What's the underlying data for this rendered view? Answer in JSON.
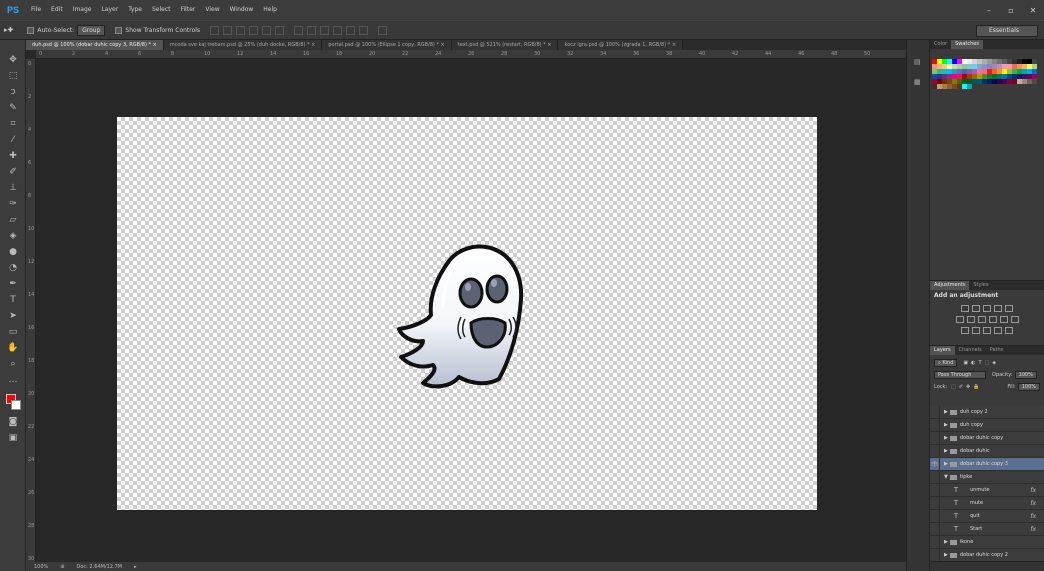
{
  "app": {
    "logo": "PS"
  },
  "menu": [
    "File",
    "Edit",
    "Image",
    "Layer",
    "Type",
    "Select",
    "Filter",
    "View",
    "Window",
    "Help"
  ],
  "window_controls": [
    "–",
    "▫",
    "✕"
  ],
  "options_bar": {
    "move_tool_glyph": "▸✚",
    "auto_select_label": "Auto-Select:",
    "auto_select_value": "Group",
    "show_transform_label": "Show Transform Controls",
    "workspace": "Essentials"
  },
  "doc_tabs": [
    "duh.psd @ 100% (dobar duhic copy 3, RGB/8) * ×",
    "mcoda sve kaj trebam.psd @ 25% (duh docke, RGB/8) * ×",
    "portal.psd @ 100% (Ellipse 1 copy, RGB/8) * ×",
    "text.psd @ 521% (restart, RGB/8) * ×",
    "kocz igra.psd @ 100% (zgrada 1, RGB/8) * ×"
  ],
  "ruler_h": [
    "0",
    "2",
    "4",
    "6",
    "8",
    "10",
    "12",
    "14",
    "16",
    "18",
    "20",
    "22",
    "24",
    "26",
    "28",
    "30",
    "32",
    "34",
    "36",
    "38",
    "40",
    "42",
    "44",
    "46",
    "48",
    "50"
  ],
  "ruler_v": [
    "0",
    "2",
    "4",
    "6",
    "8",
    "10",
    "12",
    "14",
    "16",
    "18",
    "20",
    "22",
    "24",
    "26",
    "28",
    "30"
  ],
  "status": {
    "zoom": "100%",
    "doc_info": "Doc: 2.64M/12.7M"
  },
  "swatches_panel": {
    "tabs": [
      "Color",
      "Swatches"
    ],
    "active": "Swatches"
  },
  "swatch_colors": [
    "#ff0000",
    "#ffff00",
    "#00ff00",
    "#00ffff",
    "#0000ff",
    "#ff00ff",
    "#ffffff",
    "#ebebeb",
    "#d6d6d6",
    "#c2c2c2",
    "#adadad",
    "#999999",
    "#858585",
    "#707070",
    "#5c5c5c",
    "#474747",
    "#333333",
    "#1f1f1f",
    "#0a0a0a",
    "#000000",
    "#444444",
    "#f7977a",
    "#f9ad81",
    "#fdc68a",
    "#fff79a",
    "#c4df9b",
    "#a2d39c",
    "#82ca9d",
    "#7bcdc8",
    "#6ecff6",
    "#7ea7d8",
    "#8493ca",
    "#8882be",
    "#a187be",
    "#bc8dbf",
    "#f49ac2",
    "#f6989d",
    "#f26c4f",
    "#f68e55",
    "#fbaf5c",
    "#fff467",
    "#acd372",
    "#7cc576",
    "#3bb878",
    "#1abbb4",
    "#00bff3",
    "#438cca",
    "#5574b9",
    "#605ca8",
    "#855fa8",
    "#a763a8",
    "#f06ea9",
    "#f26d7d",
    "#ed1c24",
    "#f26522",
    "#f7941d",
    "#fff200",
    "#8dc73f",
    "#39b54a",
    "#00a651",
    "#00a99d",
    "#00aeef",
    "#0072bc",
    "#0054a6",
    "#2e3192",
    "#662d91",
    "#92278f",
    "#ec008c",
    "#ed145b",
    "#9e0b0f",
    "#a0410d",
    "#a36209",
    "#aba000",
    "#598527",
    "#1a7b30",
    "#007236",
    "#00746b",
    "#0076a3",
    "#004b80",
    "#003471",
    "#1b1464",
    "#440e62",
    "#630460",
    "#9e005d",
    "#9e0039",
    "#790000",
    "#7b2e00",
    "#7d4900",
    "#827b00",
    "#406618",
    "#005e20",
    "#005826",
    "#005952",
    "#005b7f",
    "#003663",
    "#002157",
    "#0d004c",
    "#32004b",
    "#4b0049",
    "#7b0046",
    "#7a0026",
    "#c7b299",
    "#998675",
    "#736357",
    "#534741",
    "#37302d",
    "#c69c6d",
    "#a67c52",
    "#8c6239",
    "#754c24",
    "#603913",
    "#00ffff",
    "#0fa3a3",
    "#3a3a3a"
  ],
  "adjustments_panel": {
    "tabs": [
      "Adjustments",
      "Styles"
    ],
    "active": "Adjustments",
    "title": "Add an adjustment"
  },
  "layers_panel": {
    "tabs": [
      "Layers",
      "Channels",
      "Paths"
    ],
    "active": "Layers",
    "filter_label": "Kind",
    "blend_mode": "Pass Through",
    "opacity_label": "Opacity:",
    "opacity": "100%",
    "lock_label": "Lock:",
    "fill_label": "Fill:",
    "fill": "100%",
    "layers": [
      {
        "name": "duh copy 2",
        "kind": "group",
        "expanded": false,
        "visible": false,
        "selected": false,
        "fx": false,
        "indent": 0
      },
      {
        "name": "duh copy",
        "kind": "group",
        "expanded": false,
        "visible": false,
        "selected": false,
        "fx": false,
        "indent": 0
      },
      {
        "name": "dobar duhic copy",
        "kind": "group",
        "expanded": false,
        "visible": false,
        "selected": false,
        "fx": false,
        "indent": 0
      },
      {
        "name": "dobar duhic",
        "kind": "group",
        "expanded": false,
        "visible": false,
        "selected": false,
        "fx": false,
        "indent": 0
      },
      {
        "name": "dobar duhic copy 3",
        "kind": "group",
        "expanded": false,
        "visible": true,
        "selected": true,
        "fx": false,
        "indent": 0
      },
      {
        "name": "tipke",
        "kind": "group",
        "expanded": true,
        "visible": false,
        "selected": false,
        "fx": false,
        "indent": 0
      },
      {
        "name": "unmute",
        "kind": "text",
        "expanded": false,
        "visible": false,
        "selected": false,
        "fx": true,
        "indent": 1
      },
      {
        "name": "mute",
        "kind": "text",
        "expanded": false,
        "visible": false,
        "selected": false,
        "fx": true,
        "indent": 1
      },
      {
        "name": "quit",
        "kind": "text",
        "expanded": false,
        "visible": false,
        "selected": false,
        "fx": true,
        "indent": 1
      },
      {
        "name": "Start",
        "kind": "text",
        "expanded": false,
        "visible": false,
        "selected": false,
        "fx": true,
        "indent": 1
      },
      {
        "name": "ikone",
        "kind": "group",
        "expanded": false,
        "visible": false,
        "selected": false,
        "fx": false,
        "indent": 0
      },
      {
        "name": "dobar duhic copy 2",
        "kind": "group",
        "expanded": false,
        "visible": false,
        "selected": false,
        "fx": false,
        "indent": 0
      }
    ]
  }
}
